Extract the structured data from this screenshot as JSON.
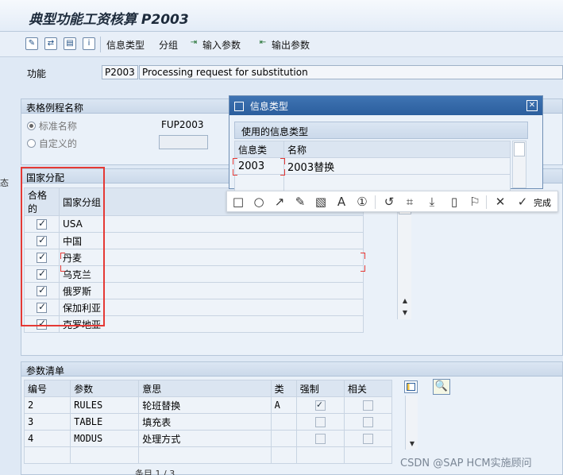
{
  "header": {
    "title": "典型功能工资核算 P2003"
  },
  "toolbar": {
    "info_type": "信息类型",
    "group": "分组",
    "input_params": "输入参数",
    "output_params": "输出参数"
  },
  "function": {
    "label": "功能",
    "code": "P2003",
    "description": "Processing request for substitution"
  },
  "table_routine": {
    "header": "表格例程名称",
    "standard_name": "标准名称",
    "custom": "自定义的",
    "standard_value": "FUP2003"
  },
  "country": {
    "header": "国家分配",
    "col_ok": "合格的",
    "col_group": "国家分组",
    "rows": [
      {
        "group": "USA",
        "checked": true
      },
      {
        "group": "中国",
        "checked": true
      },
      {
        "group": "丹麦",
        "checked": true
      },
      {
        "group": "乌克兰",
        "checked": true
      },
      {
        "group": "俄罗斯",
        "checked": true
      },
      {
        "group": "保加利亚",
        "checked": true
      },
      {
        "group": "克罗地亚",
        "checked": true
      }
    ]
  },
  "params": {
    "header": "参数清单",
    "columns": [
      "编号",
      "参数",
      "意思",
      "类",
      "强制",
      "相关"
    ],
    "rows": [
      {
        "num": "2",
        "param": "RULES",
        "meaning": "轮班替换",
        "cls": "A",
        "mandatory": true,
        "related": false
      },
      {
        "num": "3",
        "param": "TABLE",
        "meaning": "填充表",
        "cls": "",
        "mandatory": false,
        "related": false
      },
      {
        "num": "4",
        "param": "MODUS",
        "meaning": "处理方式",
        "cls": "",
        "mandatory": false,
        "related": false
      }
    ]
  },
  "dialog": {
    "title": "信息类型",
    "section": "使用的信息类型",
    "col_type": "信息类",
    "col_name": "名称",
    "rows": [
      {
        "type": "2003",
        "name": "2003替换"
      }
    ]
  },
  "annotation": {
    "done": "完成"
  },
  "left_edge_char": "态",
  "watermark": "CSDN @SAP HCM实施顾问",
  "bottom_text": "条目 1 / 3",
  "colors": {
    "highlight": "#e53935",
    "dialog_title": "#2b5e9d"
  }
}
